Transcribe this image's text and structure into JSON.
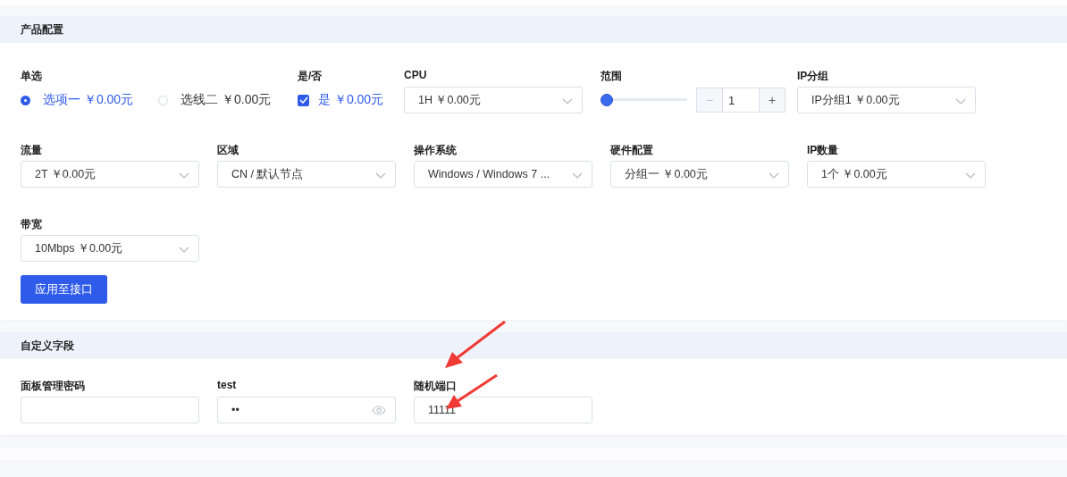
{
  "sections": [
    {
      "title": "产品配置",
      "rows": [
        [
          {
            "kind": "radio_group",
            "label": "单选",
            "options": [
              {
                "text": "选项一 ￥0.00元",
                "selected": true
              },
              {
                "text": "选线二 ￥0.00元",
                "selected": false
              }
            ]
          },
          {
            "kind": "checkbox",
            "label": "是/否",
            "text": "是 ￥0.00元",
            "checked": true
          },
          {
            "kind": "select",
            "label": "CPU",
            "value": "1H ￥0.00元"
          },
          {
            "kind": "slider",
            "label": "范围",
            "level": 0,
            "value": "1",
            "minus": "−",
            "plus": "+",
            "minus_disabled": true
          },
          {
            "kind": "select",
            "label": "IP分组",
            "value": "IP分组1 ￥0.00元"
          }
        ],
        [
          {
            "kind": "select",
            "label": "流量",
            "value": "2T ￥0.00元"
          },
          {
            "kind": "select",
            "label": "区域",
            "value": "CN / 默认节点"
          },
          {
            "kind": "select",
            "label": "操作系统",
            "value": "Windows / Windows 7 ..."
          },
          {
            "kind": "select",
            "label": "硬件配置",
            "value": "分组一 ￥0.00元"
          },
          {
            "kind": "select",
            "label": "IP数量",
            "value": "1个 ￥0.00元"
          }
        ],
        [
          {
            "kind": "select",
            "label": "带宽",
            "value": "10Mbps ￥0.00元"
          }
        ]
      ],
      "button": "应用至接口"
    },
    {
      "title": "自定义字段",
      "rows": [
        [
          {
            "kind": "input",
            "label": "面板管理密码"
          },
          {
            "kind": "password",
            "label": "test",
            "value": "••"
          },
          {
            "kind": "input",
            "label": "随机端口",
            "value": "11111"
          }
        ]
      ]
    }
  ]
}
